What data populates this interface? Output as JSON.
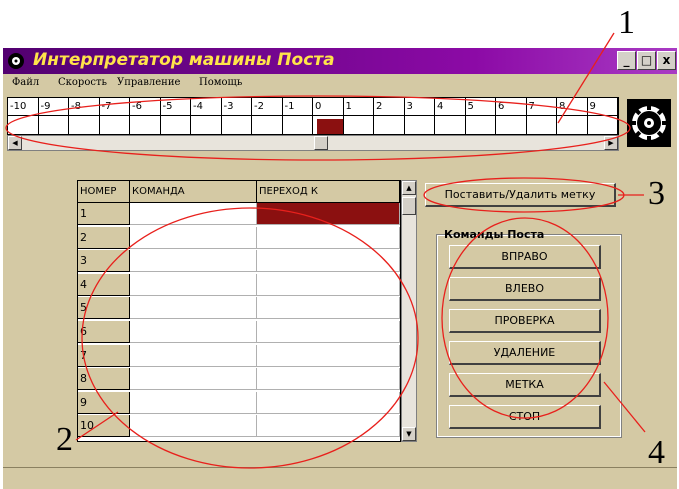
{
  "window": {
    "title": "Интерпретатор машины Поста",
    "controls": {
      "minimize": "_",
      "maximize": "□",
      "close": "x"
    }
  },
  "menu": [
    "Файл",
    "Скорость",
    "Управление",
    "Помощь"
  ],
  "tape": {
    "cells": [
      "-10",
      "-9",
      "-8",
      "-7",
      "-6",
      "-5",
      "-4",
      "-3",
      "-2",
      "-1",
      "0",
      "1",
      "2",
      "3",
      "4",
      "5",
      "6",
      "7",
      "8",
      "9"
    ],
    "marked_cell": "0",
    "mark_color": "#8b1010"
  },
  "program_table": {
    "headers": [
      "НОМЕР",
      "КОМАНДА",
      "ПЕРЕХОД К"
    ],
    "rows": [
      "1",
      "2",
      "3",
      "4",
      "5",
      "6",
      "7",
      "8",
      "9",
      "10"
    ],
    "highlight_color": "#8b1010"
  },
  "set_mark_button": "Поставить/Удалить метку",
  "commands": {
    "title": "Команды Поста",
    "buttons": [
      "ВПРАВО",
      "ВЛЕВО",
      "ПРОВЕРКА",
      "УДАЛЕНИЕ",
      "МЕТКА",
      "СТОП"
    ]
  },
  "callouts": [
    "1",
    "2",
    "3",
    "4"
  ],
  "colors": {
    "title_bar": "#7a0a96",
    "title_text": "#ffe44a",
    "window_bg": "#d4c9a4",
    "annotation": "#e8201c"
  },
  "icons": {
    "app": "gear-icon",
    "status": "gear-icon"
  }
}
